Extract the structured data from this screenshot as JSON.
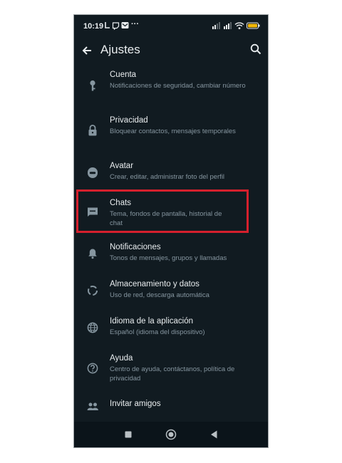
{
  "status": {
    "time": "10:19",
    "more": "···"
  },
  "header": {
    "title": "Ajustes"
  },
  "settings": [
    {
      "title": "Cuenta",
      "subtitle": "Notificaciones de seguridad, cambiar número",
      "icon": "key-icon"
    },
    {
      "title": "Privacidad",
      "subtitle": "Bloquear contactos, mensajes temporales",
      "icon": "lock-icon"
    },
    {
      "title": "Avatar",
      "subtitle": "Crear, editar, administrar foto del perfil",
      "icon": "avatar-icon"
    },
    {
      "title": "Chats",
      "subtitle": "Tema, fondos de pantalla, historial de chat",
      "icon": "chat-icon"
    },
    {
      "title": "Notificaciones",
      "subtitle": "Tonos de mensajes, grupos y llamadas",
      "icon": "bell-icon"
    },
    {
      "title": "Almacenamiento y datos",
      "subtitle": "Uso de red, descarga automática",
      "icon": "data-usage-icon"
    },
    {
      "title": "Idioma de la aplicación",
      "subtitle": "Español (idioma del dispositivo)",
      "icon": "globe-icon"
    },
    {
      "title": "Ayuda",
      "subtitle": "Centro de ayuda, contáctanos, política de privacidad",
      "icon": "help-icon"
    },
    {
      "title": "Invitar amigos",
      "icon": "people-icon"
    }
  ],
  "colors": {
    "background": "#111b21",
    "highlight": "#d5202d",
    "text": "#e9edef",
    "subtext": "#8696a0"
  }
}
